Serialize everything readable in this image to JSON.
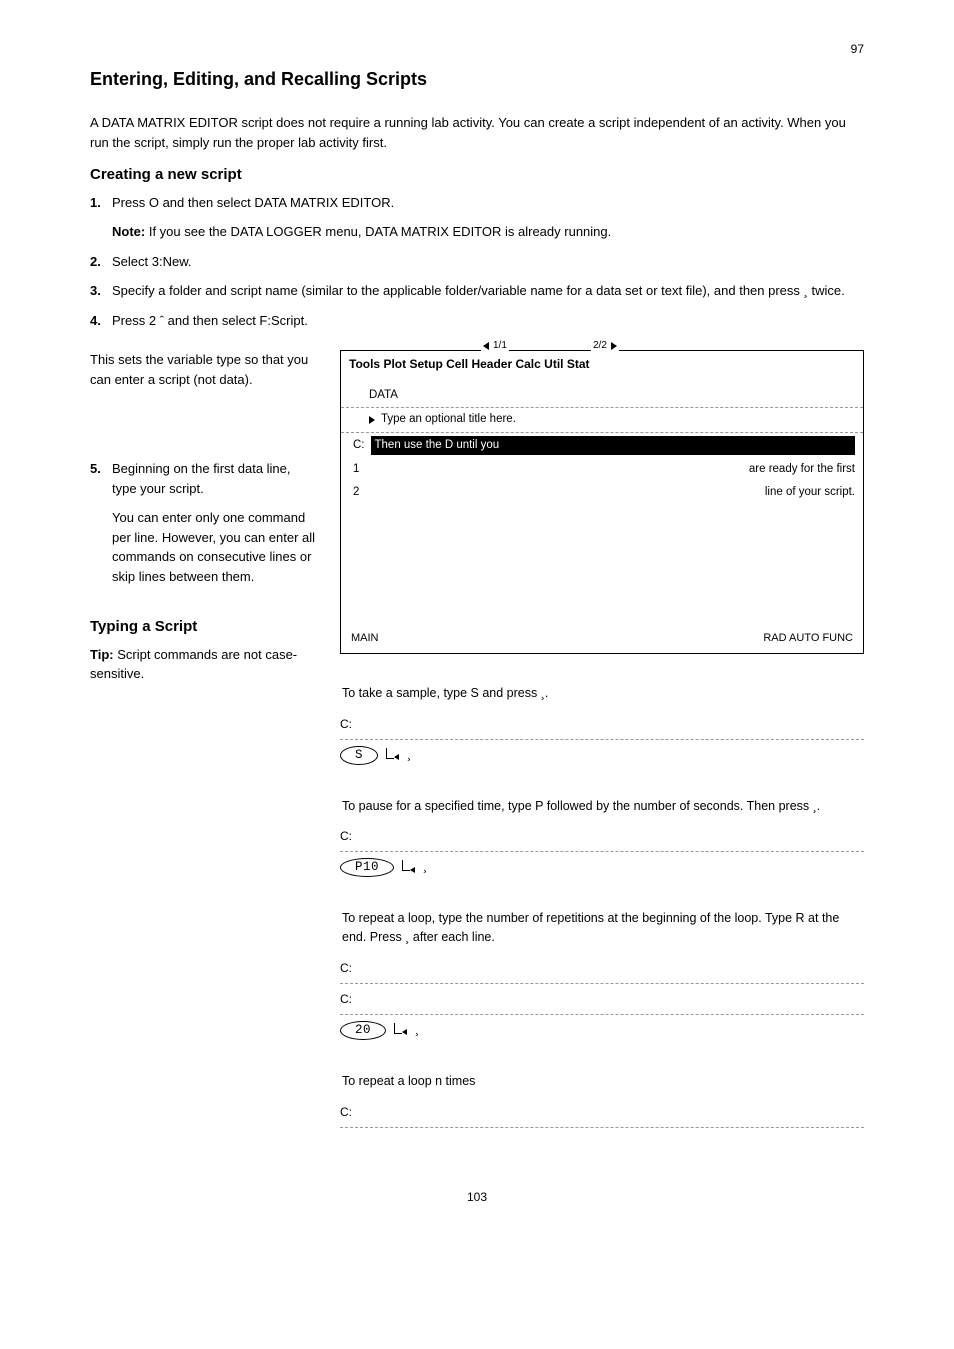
{
  "pageNumTop": "97",
  "title": "Entering, Editing, and Recalling Scripts",
  "intro": "A DATA MATRIX EDITOR script does not require a running lab activity. You can create a script independent of an activity. When you run the script, simply run the proper lab activity first.",
  "noteLabel": "Note:",
  "noteText": "If you see the DATA LOGGER menu, DATA MATRIX EDITOR is already running.",
  "section1": "Creating a new script",
  "steps": [
    {
      "num": "1.",
      "text": "Press O and then select DATA MATRIX EDITOR."
    },
    {
      "num": "2.",
      "text": "Select 3:New."
    },
    {
      "num": "3.",
      "text": "Specify a folder and script name (similar to the applicable folder/variable name for a data set or text file), and then press ¸ twice."
    },
    {
      "num": "4.",
      "text": "Press 2 ˆ and then select F:Script."
    }
  ],
  "step4Extra": "This sets the variable type so that you can enter a script (not data).",
  "step5": {
    "num": "5.",
    "text": "Beginning on the first data line, type your script."
  },
  "scriptNote": "You can enter only one command per line. However, you can enter all commands on consecutive lines or skip lines between them.",
  "menu": {
    "title": "Tools  Plot Setup Cell Header Calc Util Stat",
    "tabs": [
      "1/1",
      "2/2"
    ],
    "row1": "DATA",
    "row2": {
      "arrow": true,
      "text": "Type an optional title here."
    },
    "row3": {
      "label": "C:",
      "text": "Then use the D until you"
    },
    "row4": {
      "label": "1",
      "text": "are ready for the first"
    },
    "row5": {
      "label": "2",
      "text": "line of your script."
    },
    "bottom": {
      "left": "MAIN",
      "right": "RAD AUTO   FUNC"
    }
  },
  "examples": [
    {
      "title": "To take a sample, type S and press ¸.",
      "prompts": [
        "C:"
      ],
      "entry": "S",
      "enter": "¸"
    },
    {
      "title": "To pause for a specified time, type P followed by the number of seconds. Then press ¸.",
      "prompts": [
        "C:"
      ],
      "entry": "P10",
      "enter": "¸"
    },
    {
      "title": "To repeat a loop, type the number of repetitions at the beginning of the loop. Type R at the end. Press ¸ after each line.",
      "prompts": [
        "C:",
        "C:"
      ],
      "entry": "20",
      "enter": "¸"
    },
    {
      "title": "To repeat a loop n times",
      "prompts": [
        "C:"
      ],
      "isHeaderContinuationOnly": true
    }
  ],
  "tip": {
    "label": "Tip:",
    "text": "Script commands are not case-sensitive."
  },
  "typingHeader": "Typing a Script",
  "pageNumBottom": "103"
}
